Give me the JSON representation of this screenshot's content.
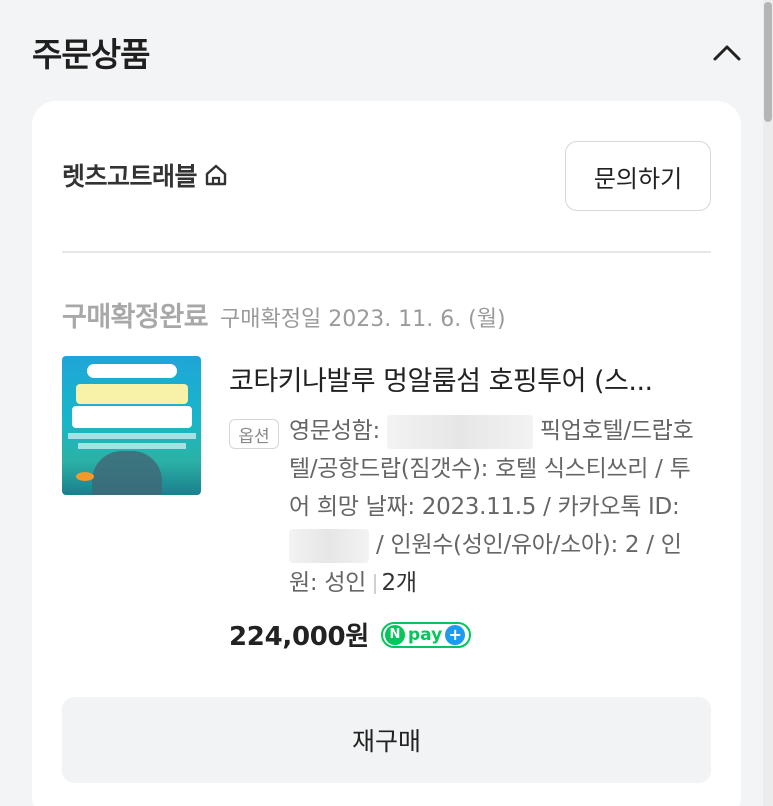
{
  "section": {
    "title": "주문상품",
    "collapse_icon": "chevron-up-icon"
  },
  "shop": {
    "name": "렛츠고트래블",
    "home_icon": "home-icon",
    "inquiry_label": "문의하기"
  },
  "order": {
    "status": "구매확정완료",
    "confirm_date": "구매확정일 2023. 11. 6. (월)"
  },
  "product": {
    "thumbnail_icon": "product-thumbnail",
    "title": "코타키나발루 멍알룸섬 호핑투어 (스...",
    "option_tag": "옵션",
    "option_part1": "영문성함:",
    "option_part2": "픽업호텔/드랍호텔/공항드랍(짐갯수): 호텔 식스티쓰리 / 투어 희망 날짜: 2023.11.5 / 카카오톡 ID:",
    "option_part3": "/ 인원수(성인/유아/소아): 2 / 인원: 성인",
    "quantity": "2개",
    "price": "224,000원",
    "npay_label": "pay",
    "npay_n": "N",
    "npay_plus": "+"
  },
  "actions": {
    "rebuy_label": "재구매"
  },
  "colors": {
    "background": "#f3f4f6",
    "card": "#ffffff",
    "npay_green": "#03c75a",
    "status_gray": "#a8a8a8"
  }
}
